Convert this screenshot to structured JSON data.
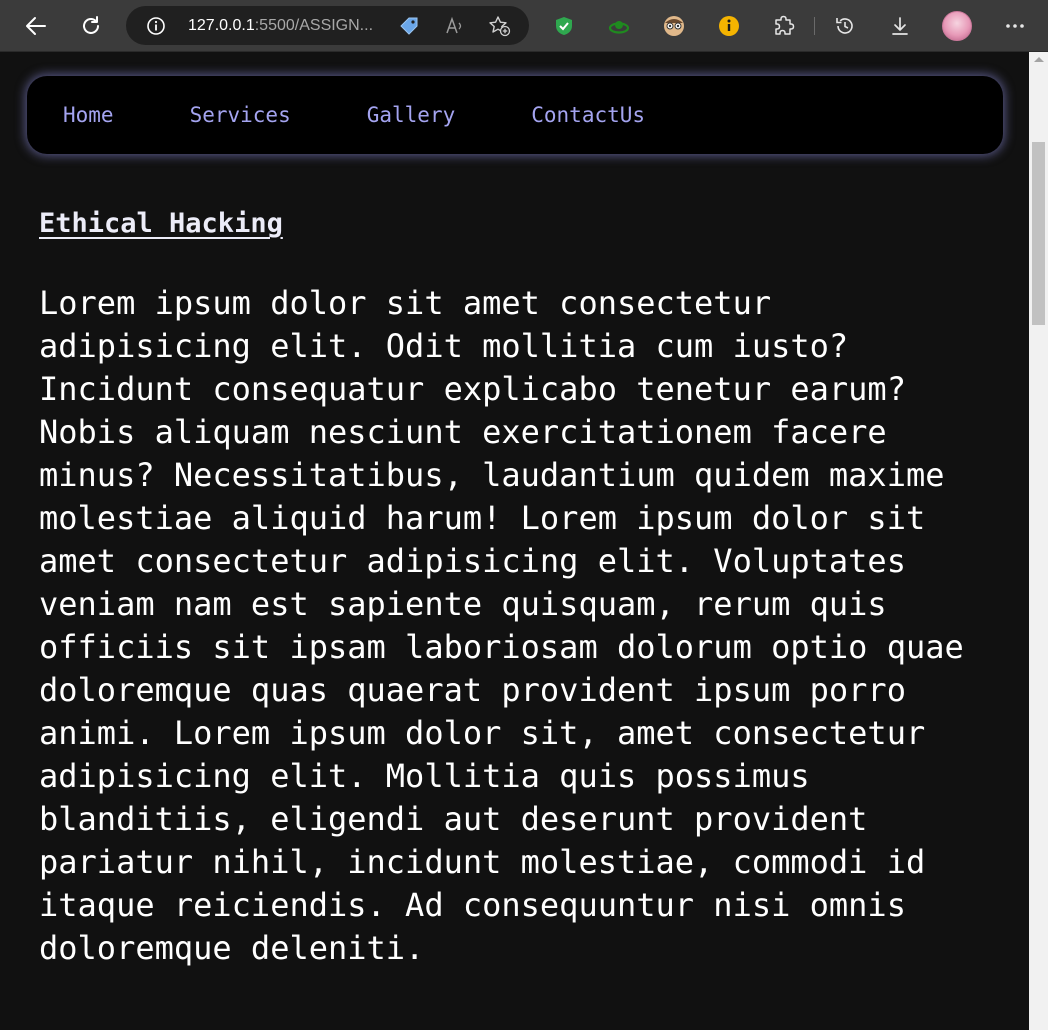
{
  "browser": {
    "address_host": "127.0.0.1",
    "address_rest": ":5500/ASSIGN...",
    "icons": [
      "back-icon",
      "refresh-icon",
      "info-icon",
      "tag-icon",
      "read-aloud-icon",
      "add-favorite-icon",
      "shield-extension-icon",
      "green-extension-icon",
      "face-extension-icon",
      "info-extension-icon",
      "extensions-puzzle-icon",
      "history-icon",
      "download-icon",
      "profile-avatar",
      "more-menu-icon"
    ]
  },
  "nav": {
    "items": [
      {
        "label": "Home"
      },
      {
        "label": "Services"
      },
      {
        "label": "Gallery"
      },
      {
        "label": "ContactUs"
      }
    ]
  },
  "main": {
    "heading": "Ethical Hacking",
    "paragraph": "Lorem ipsum dolor sit amet consectetur adipisicing elit. Odit mollitia cum iusto? Incidunt consequatur explicabo tenetur earum? Nobis aliquam nesciunt exercitationem facere minus? Necessitatibus, laudantium quidem maxime molestiae aliquid harum! Lorem ipsum dolor sit amet consectetur adipisicing elit. Voluptates veniam nam est sapiente quisquam, rerum quis officiis sit ipsam laboriosam dolorum optio quae doloremque quas quaerat provident ipsum porro animi. Lorem ipsum dolor sit, amet consectetur adipisicing elit. Mollitia quis possimus blanditiis, eligendi aut deserunt provident pariatur nihil, incidunt molestiae, commodi id itaque reiciendis. Ad consequuntur nisi omnis doloremque deleniti."
  },
  "colors": {
    "page_bg": "#111111",
    "nav_bg": "#000000",
    "nav_link": "#a4a4f0",
    "nav_glow": "#8c8cdc",
    "text": "#ffffff"
  }
}
